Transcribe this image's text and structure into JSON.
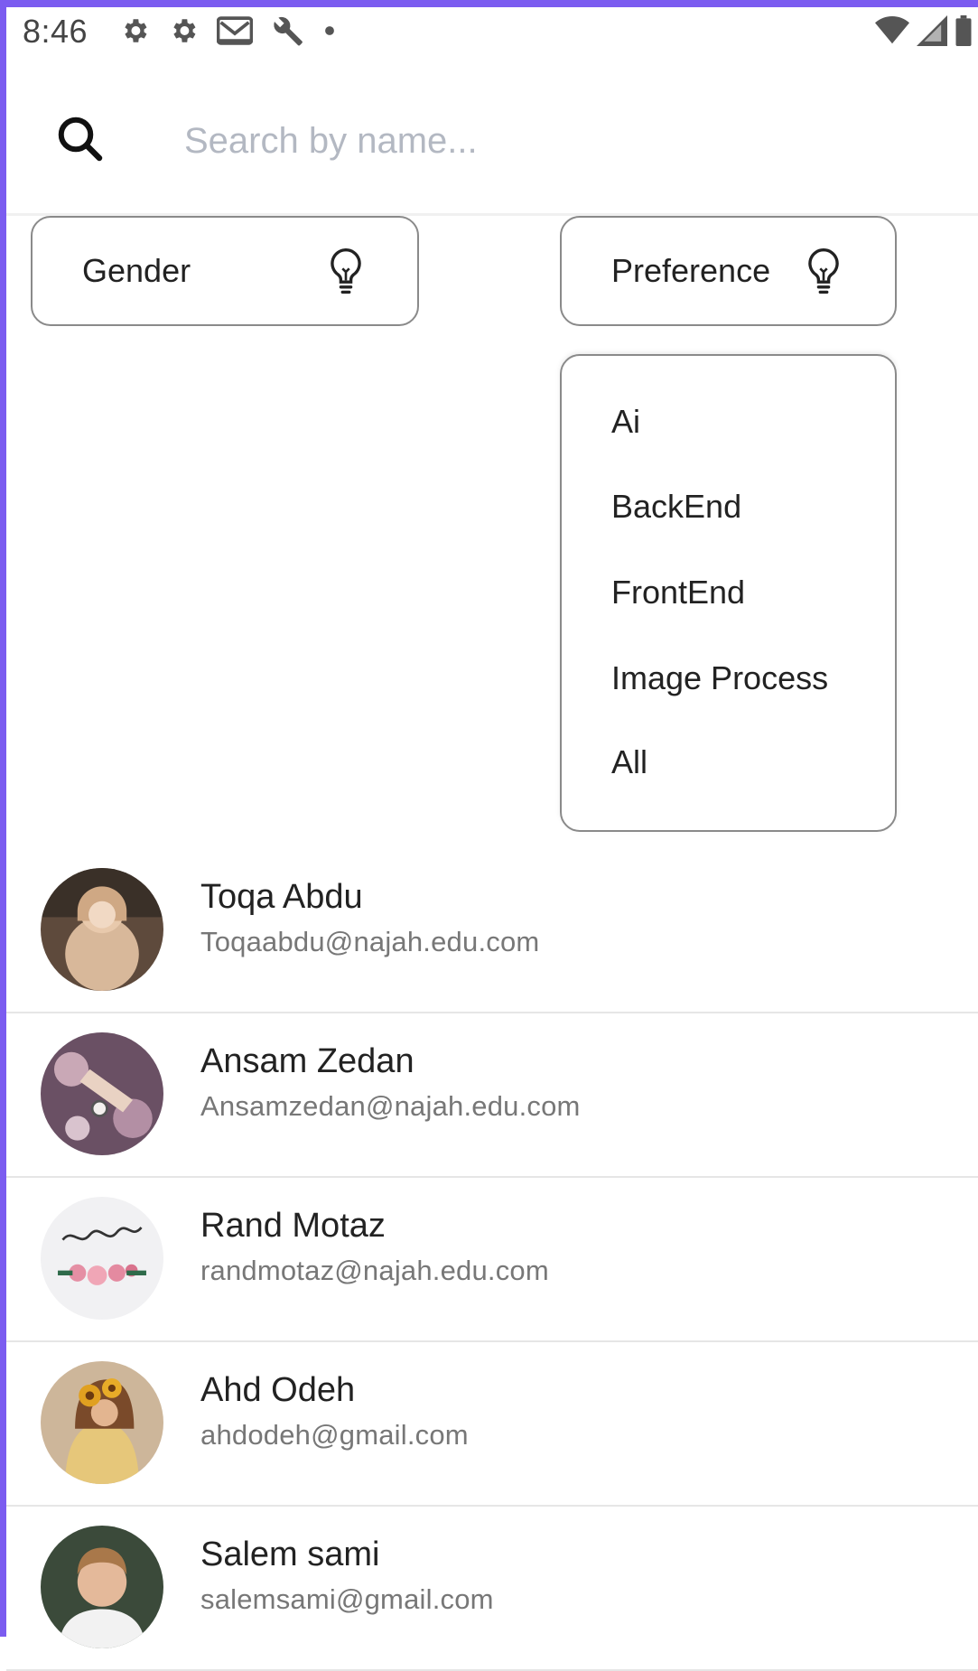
{
  "status_bar": {
    "time": "8:46",
    "left_icons": [
      "gear-icon",
      "gear-icon",
      "mail-icon",
      "wrench-icon",
      "dot-icon"
    ],
    "right_icons": [
      "wifi-icon",
      "signal-icon",
      "battery-icon"
    ]
  },
  "search": {
    "placeholder": "Search by name...",
    "value": ""
  },
  "filters": {
    "gender_label": "Gender",
    "preference_label": "Preference",
    "icon": "lightbulb-icon"
  },
  "dropdown": {
    "options": [
      "Ai",
      "BackEnd",
      "FrontEnd",
      "Image Process",
      "All"
    ]
  },
  "users": [
    {
      "name": "Toqa Abdu",
      "email": "Toqaabdu@najah.edu.com"
    },
    {
      "name": "Ansam Zedan",
      "email": "Ansamzedan@najah.edu.com"
    },
    {
      "name": "Rand Motaz",
      "email": "randmotaz@najah.edu.com"
    },
    {
      "name": "Ahd Odeh",
      "email": "ahdodeh@gmail.com"
    },
    {
      "name": "Salem sami",
      "email": "salemsami@gmail.com"
    }
  ],
  "colors": {
    "frame_accent": "#7b5cf0",
    "border": "#8a8a8a",
    "placeholder": "#b3b8c2",
    "secondary_text": "#777777"
  }
}
